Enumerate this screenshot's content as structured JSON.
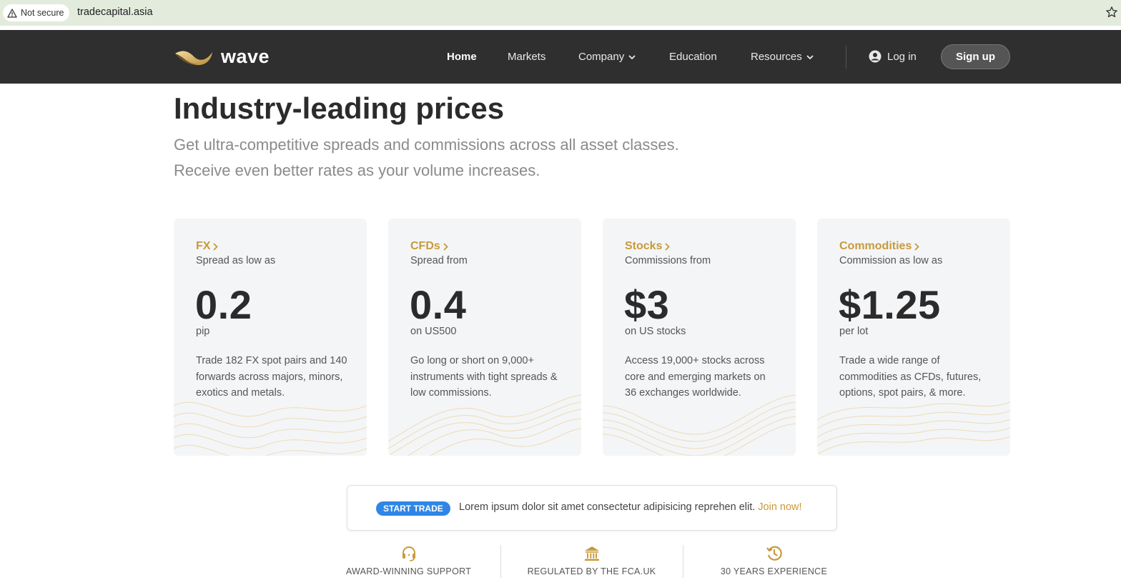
{
  "browser": {
    "security_label": "Not secure",
    "url": "tradecapital.asia"
  },
  "nav": {
    "logo_text": "wave",
    "items": [
      {
        "label": "Home",
        "active": true
      },
      {
        "label": "Markets"
      },
      {
        "label": "Company",
        "dropdown": true
      },
      {
        "label": "Education"
      },
      {
        "label": "Resources",
        "dropdown": true
      }
    ],
    "login_label": "Log in",
    "signup_label": "Sign up"
  },
  "hero": {
    "title_pre": "Industry-",
    "title_highlight": "leading",
    "title_post": " prices",
    "subtitle_line1": "Get ultra-competitive spreads and commissions across all asset classes.",
    "subtitle_line2": "Receive even better rates as your volume increases."
  },
  "cards": [
    {
      "title": "FX",
      "sub": "Spread as low as",
      "value": "0.2",
      "unit": "pip",
      "desc": "Trade 182 FX spot pairs and 140 forwards across majors, minors, exotics and metals."
    },
    {
      "title": "CFDs",
      "sub": "Spread from",
      "value": "0.4",
      "unit": "on US500",
      "desc": "Go long or short on 9,000+ instruments with tight spreads & low commissions."
    },
    {
      "title": "Stocks",
      "sub": "Commissions from",
      "value": "$3",
      "unit": "on US stocks",
      "desc": "Access 19,000+ stocks across core and emerging markets on 36 exchanges worldwide."
    },
    {
      "title": "Commodities",
      "sub": "Commission as low as",
      "value": "$1.25",
      "unit": "per lot",
      "desc": "Trade a wide range of commodities as CFDs, futures, options, spot pairs, & more."
    }
  ],
  "cta": {
    "badge": "START TRADE",
    "text": "Lorem ipsum dolor sit amet consectetur adipisicing reprehen elit.",
    "link": "Join now!"
  },
  "features": [
    {
      "icon": "headset-icon",
      "label": "AWARD-WINNING SUPPORT"
    },
    {
      "icon": "bank-icon",
      "label": "REGULATED BY THE FCA.UK"
    },
    {
      "icon": "history-icon",
      "label": "30 YEARS EXPERIENCE"
    }
  ],
  "colors": {
    "accent": "#c99a3a",
    "navbar": "#2f2f2f",
    "badge": "#2f86e6",
    "card_bg": "#f4f5f7"
  }
}
